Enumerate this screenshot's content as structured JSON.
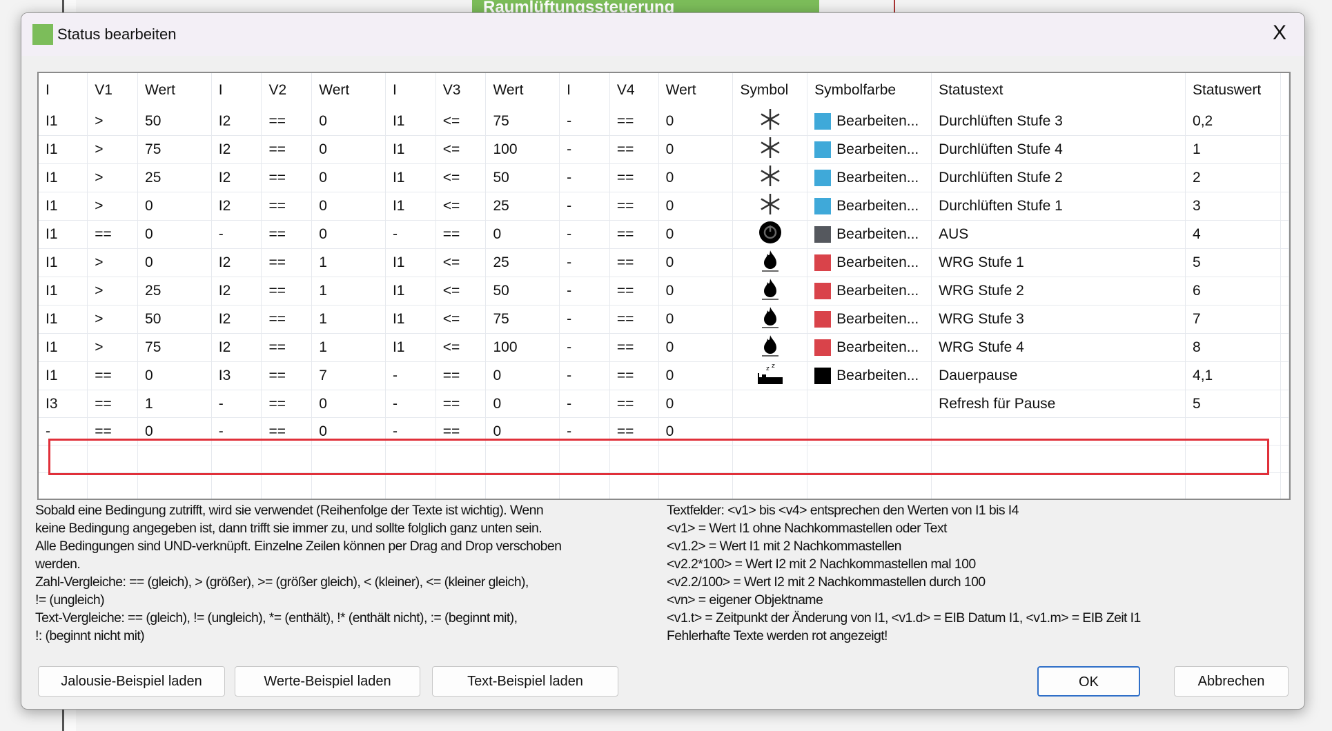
{
  "background": {
    "app_header": "Raumlüftungssteuerung"
  },
  "dialog": {
    "title": "Status bearbeiten",
    "close_label": "X"
  },
  "table": {
    "headers": [
      "I",
      "V1",
      "Wert",
      "I",
      "V2",
      "Wert",
      "I",
      "V3",
      "Wert",
      "I",
      "V4",
      "Wert",
      "Symbol",
      "Symbolfarbe",
      "Statustext",
      "Statuswert"
    ],
    "rows": [
      {
        "c": [
          "I1",
          ">",
          "50",
          "I2",
          "==",
          "0",
          "I1",
          "<=",
          "75",
          "-",
          "==",
          "0"
        ],
        "symbol": "snowflake",
        "color": "#3fa9d9",
        "farbe": "Bearbeiten...",
        "text": "Durchlüften Stufe 3",
        "wert": "0,2"
      },
      {
        "c": [
          "I1",
          ">",
          "75",
          "I2",
          "==",
          "0",
          "I1",
          "<=",
          "100",
          "-",
          "==",
          "0"
        ],
        "symbol": "snowflake",
        "color": "#3fa9d9",
        "farbe": "Bearbeiten...",
        "text": "Durchlüften Stufe 4",
        "wert": "1"
      },
      {
        "c": [
          "I1",
          ">",
          "25",
          "I2",
          "==",
          "0",
          "I1",
          "<=",
          "50",
          "-",
          "==",
          "0"
        ],
        "symbol": "snowflake",
        "color": "#3fa9d9",
        "farbe": "Bearbeiten...",
        "text": "Durchlüften Stufe 2",
        "wert": "2"
      },
      {
        "c": [
          "I1",
          ">",
          "0",
          "I2",
          "==",
          "0",
          "I1",
          "<=",
          "25",
          "-",
          "==",
          "0"
        ],
        "symbol": "snowflake",
        "color": "#3fa9d9",
        "farbe": "Bearbeiten...",
        "text": "Durchlüften Stufe 1",
        "wert": "3"
      },
      {
        "c": [
          "I1",
          "==",
          "0",
          "-",
          "==",
          "0",
          "-",
          "==",
          "0",
          "-",
          "==",
          "0"
        ],
        "symbol": "power",
        "color": "#55585e",
        "farbe": "Bearbeiten...",
        "text": "AUS",
        "wert": "4"
      },
      {
        "c": [
          "I1",
          ">",
          "0",
          "I2",
          "==",
          "1",
          "I1",
          "<=",
          "25",
          "-",
          "==",
          "0"
        ],
        "symbol": "flame",
        "color": "#d9434a",
        "farbe": "Bearbeiten...",
        "text": "WRG Stufe 1",
        "wert": "5"
      },
      {
        "c": [
          "I1",
          ">",
          "25",
          "I2",
          "==",
          "1",
          "I1",
          "<=",
          "50",
          "-",
          "==",
          "0"
        ],
        "symbol": "flame",
        "color": "#d9434a",
        "farbe": "Bearbeiten...",
        "text": "WRG Stufe 2",
        "wert": "6"
      },
      {
        "c": [
          "I1",
          ">",
          "50",
          "I2",
          "==",
          "1",
          "I1",
          "<=",
          "75",
          "-",
          "==",
          "0"
        ],
        "symbol": "flame",
        "color": "#d9434a",
        "farbe": "Bearbeiten...",
        "text": "WRG Stufe 3",
        "wert": "7"
      },
      {
        "c": [
          "I1",
          ">",
          "75",
          "I2",
          "==",
          "1",
          "I1",
          "<=",
          "100",
          "-",
          "==",
          "0"
        ],
        "symbol": "flame",
        "color": "#d9434a",
        "farbe": "Bearbeiten...",
        "text": "WRG Stufe 4",
        "wert": "8"
      },
      {
        "c": [
          "I1",
          "==",
          "0",
          "I3",
          "==",
          "7",
          "-",
          "==",
          "0",
          "-",
          "==",
          "0"
        ],
        "symbol": "sleep",
        "color": "#000000",
        "farbe": "Bearbeiten...",
        "text": "Dauerpause",
        "wert": "4,1"
      },
      {
        "c": [
          "I3",
          "==",
          "1",
          "-",
          "==",
          "0",
          "-",
          "==",
          "0",
          "-",
          "==",
          "0"
        ],
        "symbol": "",
        "color": "",
        "farbe": "",
        "text": "Refresh für Pause",
        "wert": "5"
      },
      {
        "c": [
          "-",
          "==",
          "0",
          "-",
          "==",
          "0",
          "-",
          "==",
          "0",
          "-",
          "==",
          "0"
        ],
        "symbol": "",
        "color": "",
        "farbe": "",
        "text": "",
        "wert": ""
      }
    ]
  },
  "help_left": [
    "Sobald eine Bedingung zutrifft, wird sie verwendet (Reihenfolge der Texte ist wichtig). Wenn",
    "keine Bedingung angegeben ist, dann trifft sie immer zu, und sollte folglich ganz unten sein.",
    "Alle Bedingungen sind UND-verknüpft. Einzelne Zeilen können per Drag and Drop verschoben",
    "werden.",
    "Zahl-Vergleiche: == (gleich), > (größer), >= (größer gleich), < (kleiner), <= (kleiner gleich),",
    "!= (ungleich)",
    "Text-Vergleiche: == (gleich), != (ungleich), *= (enthält), !* (enthält nicht), := (beginnt mit),",
    "!: (beginnt nicht mit)"
  ],
  "help_right": [
    "Textfelder: <v1> bis <v4> entsprechen den Werten von I1 bis I4",
    "<v1> = Wert I1 ohne Nachkommastellen oder Text",
    "<v1.2> = Wert I1 mit 2 Nachkommastellen",
    "<v2.2*100> = Wert I2 mit 2 Nachkommastellen mal 100",
    "<v2.2/100> = Wert I2 mit 2 Nachkommastellen durch 100",
    "<vn> = eigener Objektname",
    "<v1.t> = Zeitpunkt der Änderung von I1, <v1.d> = EIB Datum I1, <v1.m> = EIB Zeit I1",
    "Fehlerhafte Texte werden rot angezeigt!"
  ],
  "buttons": {
    "jalousie": "Jalousie-Beispiel laden",
    "werte": "Werte-Beispiel laden",
    "text": "Text-Beispiel laden",
    "ok": "OK",
    "cancel": "Abbrechen"
  },
  "highlight_color": "#e0303a"
}
